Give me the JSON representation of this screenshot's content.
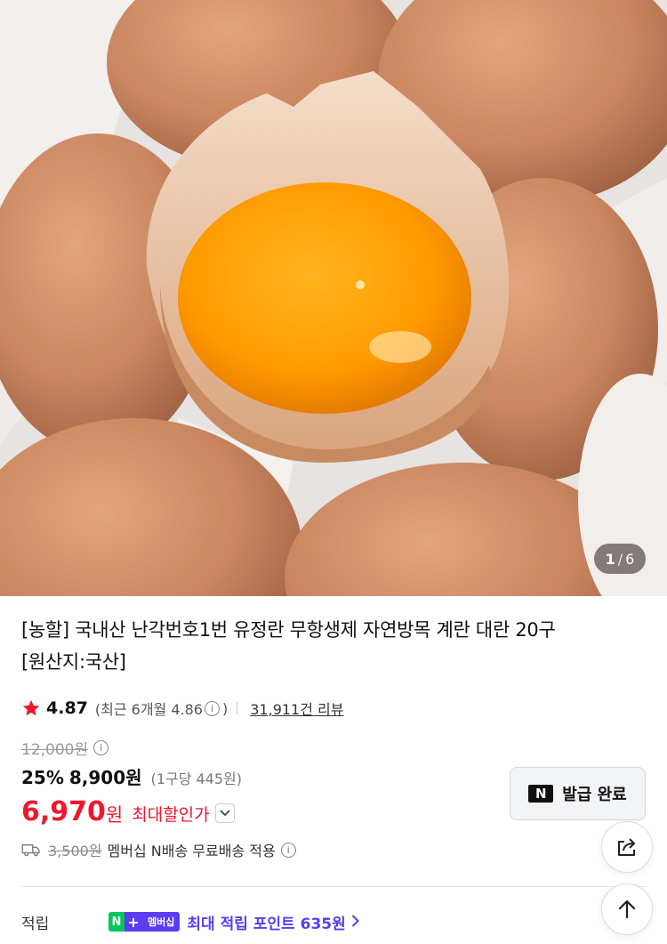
{
  "image": {
    "counter_current": "1",
    "counter_sep": "/",
    "counter_total": "6"
  },
  "product": {
    "title_line1": "[농할] 국내산 난각번호1번 유정란 무항생제 자연방목 계란 대란 20구",
    "title_line2": "[원산지:국산]"
  },
  "rating": {
    "score": "4.87",
    "recent_prefix": "(최근 6개월 4.86",
    "recent_suffix": ")",
    "info_glyph": "i",
    "reviews": "31,911건 리뷰",
    "star_color": "#f0162f"
  },
  "price": {
    "original": "12,000원",
    "discount_rate": "25%",
    "discount_price": "8,900원",
    "unit_price": "(1구당 445원)",
    "final_price": "6,970",
    "final_won": "원",
    "final_label": "최대할인가",
    "accent_color": "#f0162f"
  },
  "coupon": {
    "logo": "N",
    "label": "발급 완료"
  },
  "shipping": {
    "fee": "3,500원",
    "text": "멤버십 N배송 무료배송 적용"
  },
  "points": {
    "label": "적립",
    "badge_n": "N",
    "badge_plus": "+",
    "badge_text": "멤버십",
    "text": "최대 적립 포인트 635원",
    "accent_color": "#5b3cf0"
  },
  "icons": {
    "share": "share-icon",
    "top": "arrow-up-icon",
    "star": "star-icon",
    "truck": "truck-icon"
  }
}
